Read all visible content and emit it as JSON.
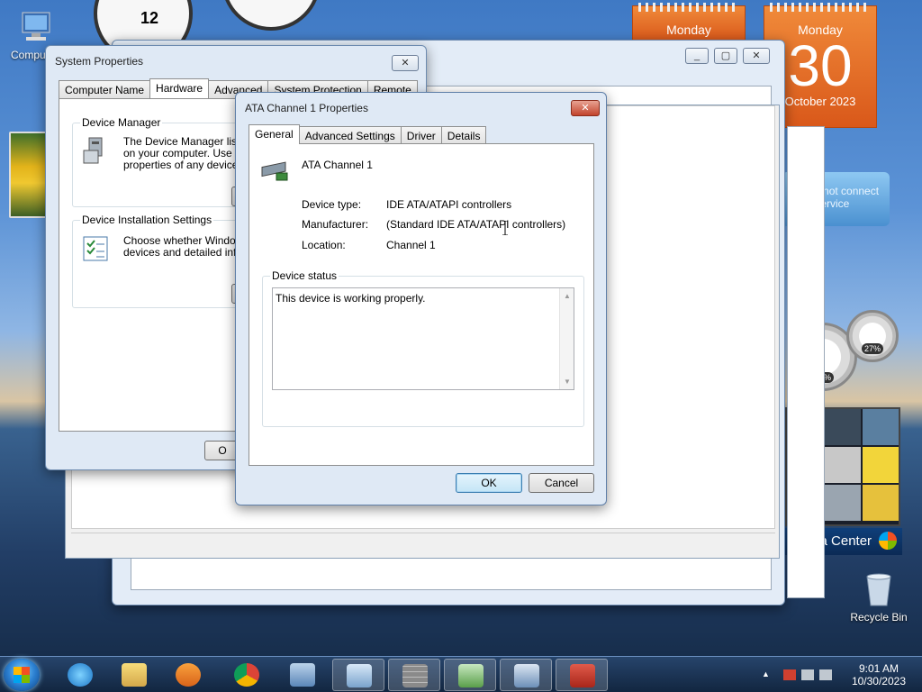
{
  "desktop": {
    "icons": [
      {
        "label": "Compu"
      },
      {
        "label": "Recycle Bin"
      }
    ]
  },
  "gadgets": {
    "clock_numeral": "12",
    "calendar_small": {
      "day": "Monday"
    },
    "calendar_large": {
      "day": "Monday",
      "date": "30",
      "month": "October 2023"
    },
    "service_message": "Cannot connect to service",
    "meters": {
      "cpu": "03%",
      "memory": "27%"
    },
    "media_center_label": "Media Center"
  },
  "system_properties": {
    "title": "System Properties",
    "tabs": [
      "Computer Name",
      "Hardware",
      "Advanced",
      "System Protection",
      "Remote"
    ],
    "active_tab": "Hardware",
    "device_manager": {
      "heading": "Device Manager",
      "text": "The Device Manager lists a on your computer. Use the properties of any device."
    },
    "device_installation": {
      "heading": "Device Installation Settings",
      "text": "Choose whether Windows devices and detailed inforn"
    },
    "ok_partial": "O"
  },
  "ata_dialog": {
    "title": "ATA Channel 1 Properties",
    "tabs": [
      "General",
      "Advanced Settings",
      "Driver",
      "Details"
    ],
    "active_tab": "General",
    "device_name": "ATA Channel 1",
    "fields": [
      {
        "label": "Device type:",
        "value": "IDE ATA/ATAPI controllers"
      },
      {
        "label": "Manufacturer:",
        "value": "(Standard IDE ATA/ATAPI controllers)"
      },
      {
        "label": "Location:",
        "value": "Channel 1"
      }
    ],
    "status_legend": "Device status",
    "status_text": "This device is working properly.",
    "ok_label": "OK",
    "cancel_label": "Cancel"
  },
  "taskbar": {
    "time": "9:01 AM",
    "date": "10/30/2023"
  },
  "colors": {
    "accent": "#2b7fd0",
    "calendar": "#e06a24",
    "close_button": "#c2432b"
  }
}
